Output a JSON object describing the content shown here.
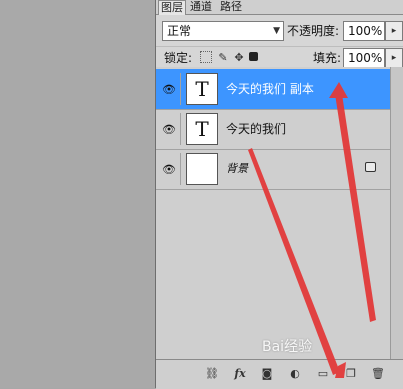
{
  "tabs": [
    {
      "label": "图层",
      "active": true
    },
    {
      "label": "通道",
      "active": false
    },
    {
      "label": "路径",
      "active": false
    }
  ],
  "blend": {
    "mode": "正常",
    "opacity_label": "不透明度:",
    "opacity": "100%"
  },
  "lock": {
    "label": "锁定:",
    "fill_label": "填充:",
    "fill": "100%",
    "icons": [
      "lock-transparent-icon",
      "lock-brush-icon",
      "lock-move-icon",
      "lock-all-icon"
    ]
  },
  "layers": [
    {
      "name": "今天的我们 副本",
      "thumb": "T",
      "selected": true,
      "italic": false,
      "locked": false
    },
    {
      "name": "今天的我们",
      "thumb": "T",
      "selected": false,
      "italic": false,
      "locked": false
    },
    {
      "name": "背景",
      "thumb": "",
      "selected": false,
      "italic": true,
      "locked": true
    }
  ],
  "bottom_icons": [
    "link-icon",
    "fx-icon",
    "mask-icon",
    "adjustment-icon",
    "group-icon",
    "new-layer-icon",
    "trash-icon"
  ],
  "bottom_labels": {
    "fx": "fx"
  },
  "watermark": "Bai经验",
  "colors": {
    "selection": "#3d95ff",
    "arrow": "#e23a3a"
  }
}
